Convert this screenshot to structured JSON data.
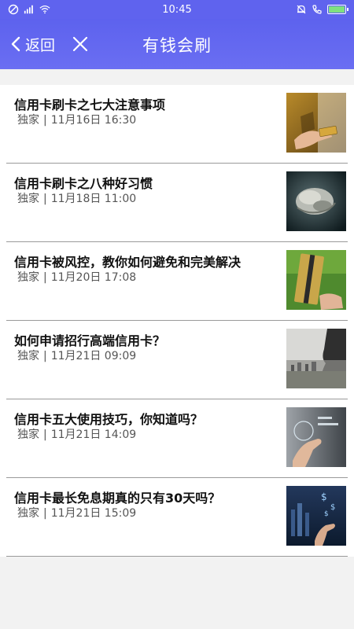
{
  "status_bar": {
    "time": "10:45",
    "icons_left": [
      "blocked-icon",
      "sim-signal-icon",
      "wifi-icon"
    ],
    "icons_right": [
      "bell-off-icon",
      "call-icon",
      "battery-icon"
    ]
  },
  "header": {
    "back_label": "返回",
    "title": "有钱会刷"
  },
  "articles": [
    {
      "title": "信用卡刷卡之七大注意事项",
      "source": "独家",
      "date": "11月16日 16:30",
      "thumb_icon": "card-swipe-photo"
    },
    {
      "title": "信用卡刷卡之八种好习惯",
      "source": "独家",
      "date": "11月18日 11:00",
      "thumb_icon": "cloud-rock-photo"
    },
    {
      "title": "信用卡被风控，教你如何避免和完美解决",
      "source": "独家",
      "date": "11月20日 17:08",
      "thumb_icon": "card-in-hand-photo"
    },
    {
      "title": "如何申请招行高端信用卡？",
      "source": "独家",
      "date": "11月21日 09:09",
      "thumb_icon": "city-profile-photo"
    },
    {
      "title": "信用卡五大使用技巧，你知道吗？",
      "source": "独家",
      "date": "11月21日 14:09",
      "thumb_icon": "finger-touch-photo"
    },
    {
      "title": "信用卡最长免息期真的只有30天吗？",
      "source": "独家",
      "date": "11月21日 15:09",
      "thumb_icon": "dollar-hand-photo"
    }
  ],
  "colors": {
    "header_bg": "#5f63ee",
    "divider": "#9a9a9a",
    "page_bg": "#f2f2f2"
  }
}
